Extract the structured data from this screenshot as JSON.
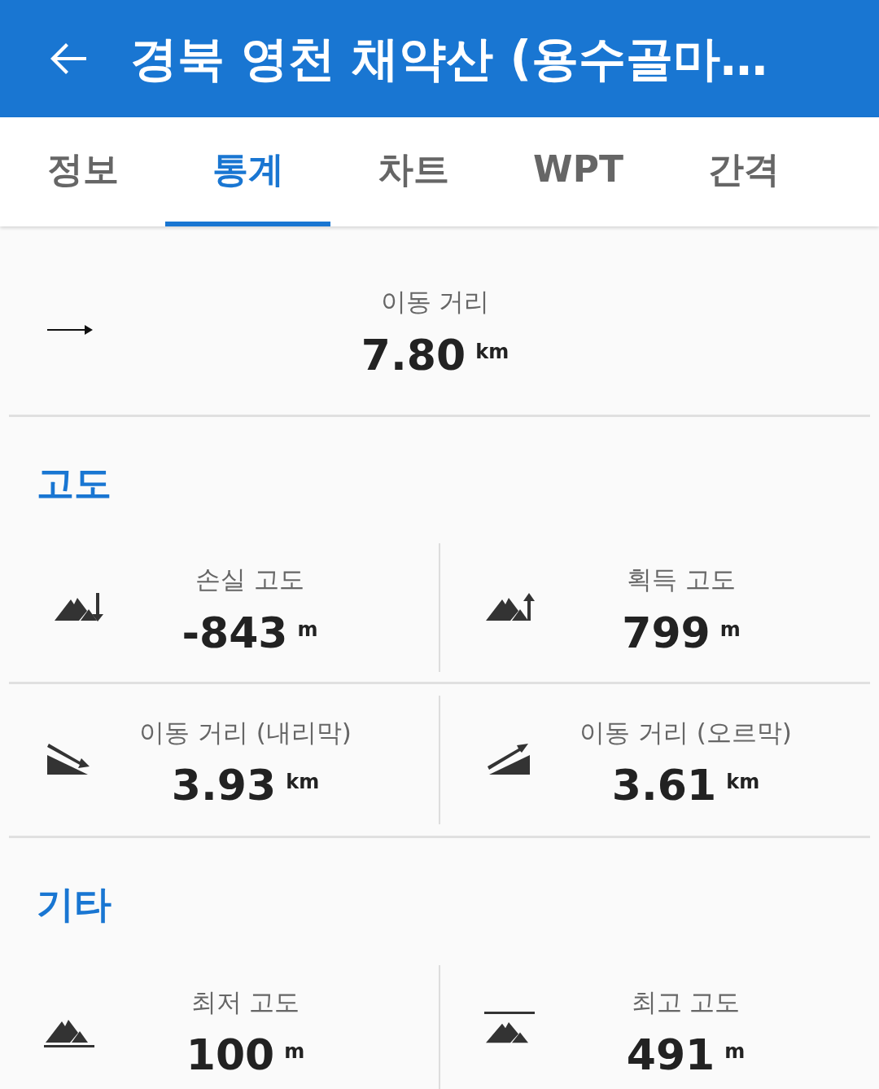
{
  "header": {
    "title": "경북 영천 채약산 (용수골마…"
  },
  "tabs": [
    {
      "label": "정보",
      "selected": false
    },
    {
      "label": "통계",
      "selected": true
    },
    {
      "label": "차트",
      "selected": false
    },
    {
      "label": "WPT",
      "selected": false
    },
    {
      "label": "간격",
      "selected": false
    }
  ],
  "summary": {
    "kind": "distance",
    "label": "이동 거리",
    "value": "7.80",
    "unit": "km"
  },
  "sections": [
    {
      "title": "고도",
      "rows": [
        [
          {
            "kind": "descent",
            "label": "손실 고도",
            "value": "-843",
            "unit": "m"
          },
          {
            "kind": "ascent",
            "label": "획득 고도",
            "value": "799",
            "unit": "m"
          }
        ],
        [
          {
            "kind": "downhill",
            "label": "이동 거리 (내리막)",
            "value": "3.93",
            "unit": "km"
          },
          {
            "kind": "uphill",
            "label": "이동 거리 (오르막)",
            "value": "3.61",
            "unit": "km"
          }
        ]
      ]
    },
    {
      "title": "기타",
      "rows": [
        [
          {
            "kind": "min",
            "label": "최저 고도",
            "value": "100",
            "unit": "m"
          },
          {
            "kind": "max",
            "label": "최고 고도",
            "value": "491",
            "unit": "m"
          }
        ]
      ]
    }
  ]
}
